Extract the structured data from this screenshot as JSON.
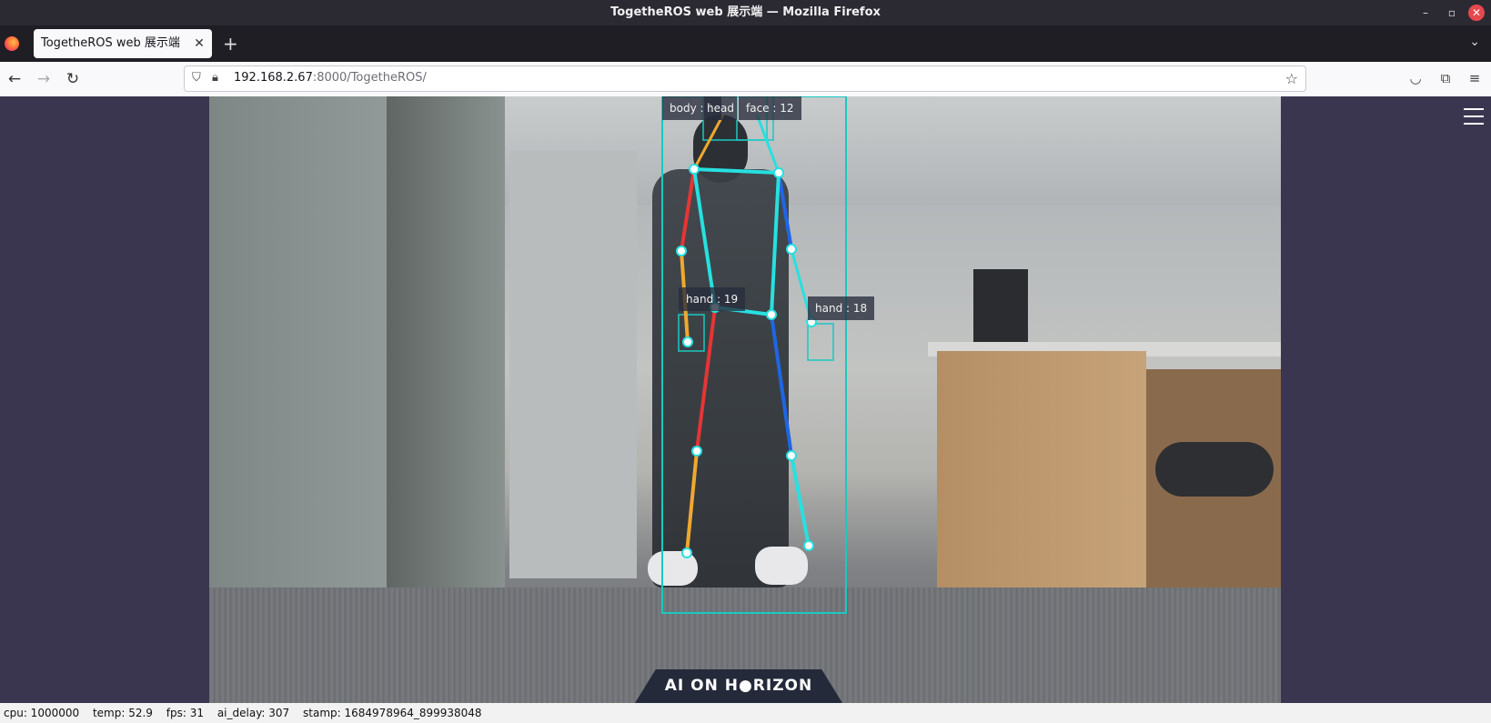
{
  "window": {
    "title": "TogetheROS web 展示端 — Mozilla Firefox",
    "minimize": "–",
    "restore": "▫",
    "close": "✕"
  },
  "tab": {
    "title": "TogetheROS web 展示端",
    "close": "✕",
    "new_tab": "+",
    "list": "⌄"
  },
  "nav": {
    "back": "←",
    "forward": "→",
    "reload": "↻",
    "url_host": "192.168.2.67",
    "url_rest": ":8000/TogetheROS/",
    "star": "☆",
    "pocket": "◡",
    "extensions": "⧉",
    "menu": "≡"
  },
  "detections": {
    "body": "body : 1",
    "head": "head",
    "face": "face : 12",
    "hand_left": "hand : 19",
    "hand_right": "hand : 18"
  },
  "logo": "AI ON H●RIZON",
  "status": {
    "cpu": "cpu: 1000000",
    "temp": "temp: 52.9",
    "fps": "fps: 31",
    "ai_delay": "ai_delay: 307",
    "stamp": "stamp: 1684978964_899938048"
  },
  "colors": {
    "bbox": "#19c9c0",
    "left_arm": "#e53535",
    "left_lower": "#f0a830",
    "right_side": "#1f66e5",
    "torso": "#27e0e0"
  }
}
